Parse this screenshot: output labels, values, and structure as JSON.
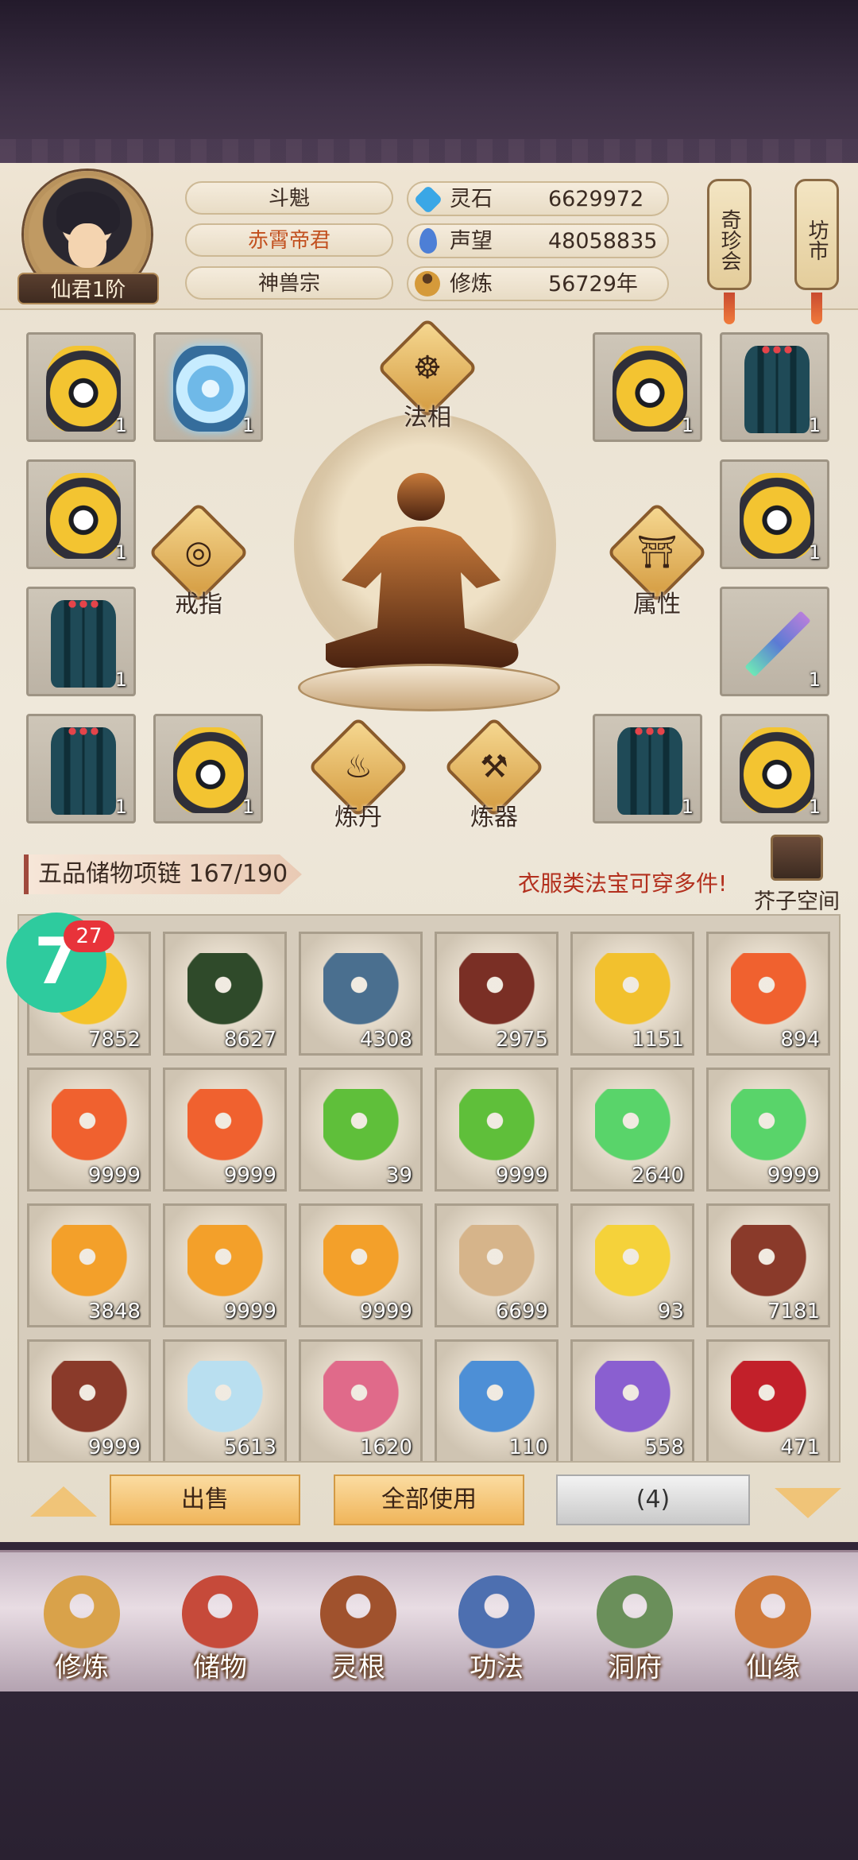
{
  "player": {
    "rank": "仙君1阶",
    "name": "斗魁",
    "title": "赤霄帝君",
    "sect": "神兽宗"
  },
  "stats": [
    {
      "label": "灵石",
      "value": "6629972",
      "icon": "spirit-stone-icon",
      "color": "#3aa7e6"
    },
    {
      "label": "声望",
      "value": "48058835",
      "icon": "prestige-icon",
      "color": "#4d7fd6"
    },
    {
      "label": "修炼",
      "value": "56729年",
      "icon": "cultivation-icon",
      "color": "#d59a3a"
    }
  ],
  "side_buttons": [
    {
      "label": "奇珍会"
    },
    {
      "label": "坊市"
    }
  ],
  "equipment": {
    "faxiang_label": "法相",
    "ring_label": "戒指",
    "attr_label": "属性",
    "alchemy_label": "炼丹",
    "forge_label": "炼器",
    "slots": [
      {
        "item": "gold-armor",
        "count": "1"
      },
      {
        "item": "ice-armor",
        "count": "1"
      },
      {
        "item": "gold-armor",
        "count": "1"
      },
      {
        "item": "teal-robe",
        "count": "1"
      },
      {
        "item": "gold-armor",
        "count": "1"
      },
      {
        "item": "gold-armor",
        "count": "1"
      },
      {
        "item": "teal-robe",
        "count": "1"
      },
      {
        "item": "sword",
        "count": "1"
      },
      {
        "item": "teal-robe",
        "count": "1"
      },
      {
        "item": "gold-armor",
        "count": "1"
      },
      {
        "item": "teal-robe",
        "count": "1"
      },
      {
        "item": "gold-armor",
        "count": "1"
      }
    ]
  },
  "bag": {
    "name": "五品储物项链 167/190",
    "hint": "衣服类法宝可穿多件!",
    "mustard_label": "芥子空间",
    "items": [
      {
        "count": "7852",
        "color": "#f5c32a"
      },
      {
        "count": "8627",
        "color": "#2f4a2a"
      },
      {
        "count": "4308",
        "color": "#4a6f8f"
      },
      {
        "count": "2975",
        "color": "#7a2f25"
      },
      {
        "count": "1151",
        "color": "#f2c12e"
      },
      {
        "count": "894",
        "color": "#f0612f"
      },
      {
        "count": "9999",
        "color": "#f0612f"
      },
      {
        "count": "9999",
        "color": "#f0612f"
      },
      {
        "count": "39",
        "color": "#5fbf3a"
      },
      {
        "count": "9999",
        "color": "#5fbf3a"
      },
      {
        "count": "2640",
        "color": "#59d46a"
      },
      {
        "count": "9999",
        "color": "#59d46a"
      },
      {
        "count": "3848",
        "color": "#f3a02a"
      },
      {
        "count": "9999",
        "color": "#f3a02a"
      },
      {
        "count": "9999",
        "color": "#f3a02a"
      },
      {
        "count": "6699",
        "color": "#d6b48a"
      },
      {
        "count": "93",
        "color": "#f5d23a"
      },
      {
        "count": "7181",
        "color": "#8a3a2a"
      },
      {
        "count": "9999",
        "color": "#8a3a2a"
      },
      {
        "count": "5613",
        "color": "#b9dff0"
      },
      {
        "count": "1620",
        "color": "#e06a8a"
      },
      {
        "count": "110",
        "color": "#4d8fd6"
      },
      {
        "count": "558",
        "color": "#8a5fd0"
      },
      {
        "count": "471",
        "color": "#c2202a"
      }
    ]
  },
  "floating": {
    "label": "7",
    "badge": "27"
  },
  "actions": {
    "sell": "出售",
    "use_all": "全部使用",
    "count": "(4)"
  },
  "nav": [
    {
      "label": "修炼",
      "icon": "cultivate-icon",
      "color": "#d9a24a"
    },
    {
      "label": "储物",
      "icon": "storage-bag-icon",
      "color": "#c64a3a"
    },
    {
      "label": "灵根",
      "icon": "spirit-root-icon",
      "color": "#a0522d"
    },
    {
      "label": "功法",
      "icon": "scripture-icon",
      "color": "#4d6fb0"
    },
    {
      "label": "洞府",
      "icon": "cave-mansion-icon",
      "color": "#6a8f5a"
    },
    {
      "label": "仙缘",
      "icon": "gourd-icon",
      "color": "#d07a3a"
    }
  ]
}
